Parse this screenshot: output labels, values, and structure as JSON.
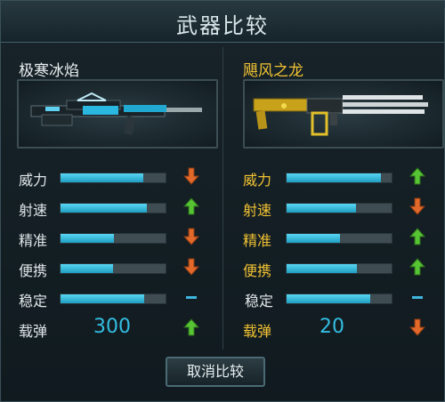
{
  "dialog": {
    "title": "武器比较",
    "cancel_label": "取消比较"
  },
  "stat_labels": {
    "power": "威力",
    "rate_of_fire": "射速",
    "accuracy": "精准",
    "portability": "便携",
    "stability": "稳定",
    "ammo": "载弹"
  },
  "left": {
    "name": "极寒冰焰",
    "stats": {
      "power": 0.79,
      "rate_of_fire": 0.82,
      "accuracy": 0.51,
      "portability": 0.5,
      "stability": 0.8
    },
    "ammo": "300",
    "indicators": {
      "power": "down",
      "rate_of_fire": "up",
      "accuracy": "down",
      "portability": "down",
      "stability": "equal",
      "ammo": "up"
    }
  },
  "right": {
    "name": "飓风之龙",
    "stats": {
      "power": 0.9,
      "rate_of_fire": 0.66,
      "accuracy": 0.51,
      "portability": 0.67,
      "stability": 0.8
    },
    "ammo": "20",
    "indicators": {
      "power": "up",
      "rate_of_fire": "down",
      "accuracy": "up",
      "portability": "up",
      "stability": "equal",
      "ammo": "down"
    }
  },
  "colors": {
    "up": "#57c434",
    "down": "#e2692a",
    "equal": "#3fb6dd",
    "bar_fill": "#33bde2",
    "gold_label": "#f1c232"
  }
}
